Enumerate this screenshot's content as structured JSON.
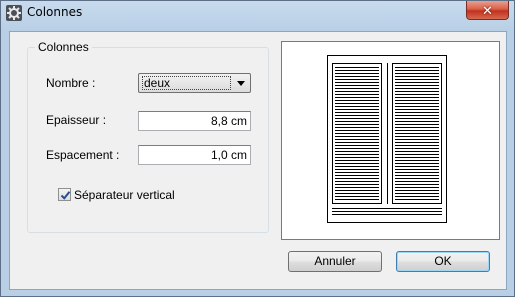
{
  "window": {
    "title": "Colonnes",
    "close_label": "✕",
    "icon": "gear-icon"
  },
  "group": {
    "title": "Colonnes",
    "nombre_label": "Nombre :",
    "nombre_value": "deux",
    "epaisseur_label": "Epaisseur :",
    "epaisseur_value": "8,8 cm",
    "espacement_label": "Espacement :",
    "espacement_value": "1,0 cm",
    "separateur_label": "Séparateur vertical",
    "separateur_checked": true
  },
  "buttons": {
    "cancel_label": "Annuler",
    "ok_label": "OK"
  },
  "colors": {
    "frame": "#b9cfe5",
    "close": "#c1321c",
    "default_button_border": "#3c7fb1"
  }
}
